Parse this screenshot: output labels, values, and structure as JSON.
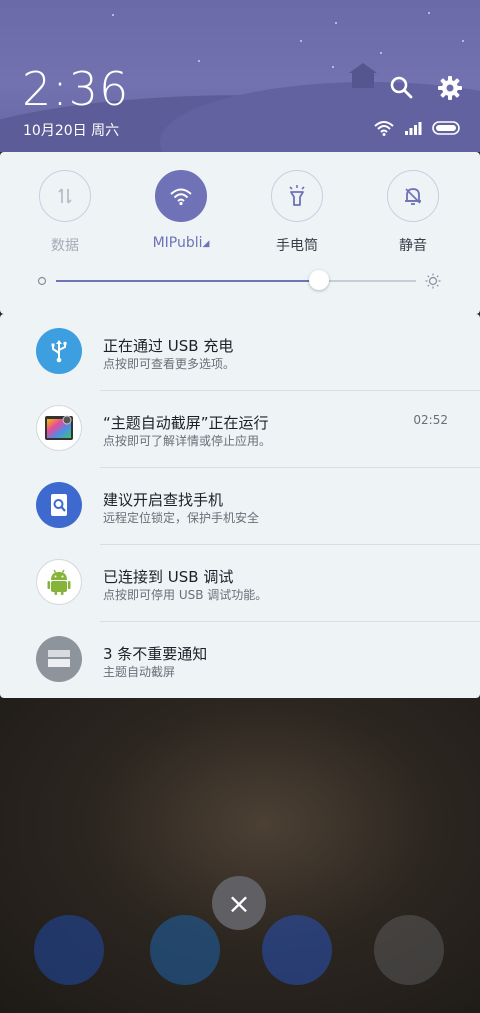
{
  "header": {
    "time": "2:36",
    "date": "10月20日 周六"
  },
  "quick_settings": {
    "toggles": [
      {
        "label": "数据",
        "state": "off"
      },
      {
        "label": "MIPubli",
        "state": "on"
      },
      {
        "label": "手电筒",
        "state": "available"
      },
      {
        "label": "静音",
        "state": "available"
      }
    ],
    "brightness_level": 0.73
  },
  "notifications": [
    {
      "title": "正在通过 USB 充电",
      "subtitle": "点按即可查看更多选项。",
      "time": "",
      "icon": "usb-icon"
    },
    {
      "title": "“主题自动截屏”正在运行",
      "subtitle": "点按即可了解详情或停止应用。",
      "time": "02:52",
      "icon": "theme-screenshot-app-icon"
    },
    {
      "title": "建议开启查找手机",
      "subtitle": "远程定位锁定，保护手机安全",
      "time": "",
      "icon": "find-phone-icon"
    },
    {
      "title": "已连接到 USB 调试",
      "subtitle": "点按即可停用 USB 调试功能。",
      "time": "",
      "icon": "android-icon"
    },
    {
      "title": "3 条不重要通知",
      "subtitle": "主题自动截屏",
      "time": "",
      "icon": "folded-notifications-icon"
    }
  ],
  "colors": {
    "accent": "#6f72b6",
    "header": "#7272b0",
    "card": "#eef3f6"
  }
}
